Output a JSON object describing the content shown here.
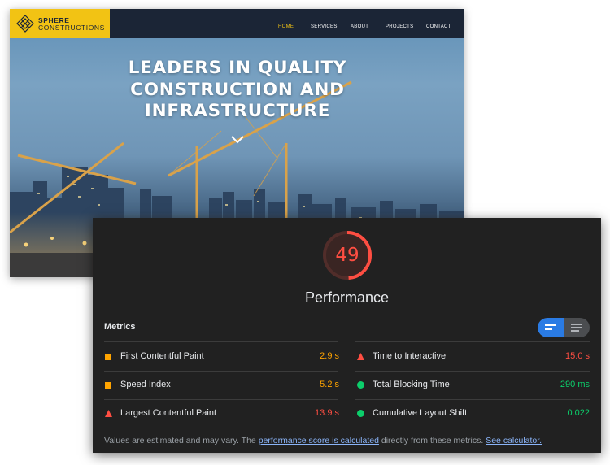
{
  "site": {
    "logo": {
      "line1": "SPHERE",
      "line2": "CONSTRUCTIONS",
      "color": "#f2c314"
    },
    "nav": [
      "HOME",
      "SERVICES",
      "ABOUT",
      "PROJECTS",
      "CONTACT"
    ],
    "nav_active": "HOME",
    "hero_title": "LEADERS IN QUALITY CONSTRUCTION AND INFRASTRUCTURE",
    "scroll_icon": "chevron-down-icon"
  },
  "report": {
    "score": "49",
    "score_fraction": 0.49,
    "score_color": "#ff4e42",
    "category": "Performance",
    "metrics_heading": "Metrics",
    "view_toggle": {
      "selected": "compact",
      "icons": [
        "compact-view-icon",
        "list-view-icon"
      ]
    },
    "metrics": [
      {
        "label": "First Contentful Paint",
        "value": "2.9 s",
        "status": "average",
        "icon": "orange-square-icon",
        "color": "#ffa400"
      },
      {
        "label": "Time to Interactive",
        "value": "15.0 s",
        "status": "fail",
        "icon": "red-triangle-icon",
        "color": "#ff4e42"
      },
      {
        "label": "Speed Index",
        "value": "5.2 s",
        "status": "average",
        "icon": "orange-square-icon",
        "color": "#ffa400"
      },
      {
        "label": "Total Blocking Time",
        "value": "290 ms",
        "status": "pass",
        "icon": "green-circle-icon",
        "color": "#0cce6b"
      },
      {
        "label": "Largest Contentful Paint",
        "value": "13.9 s",
        "status": "fail",
        "icon": "red-triangle-icon",
        "color": "#ff4e42"
      },
      {
        "label": "Cumulative Layout Shift",
        "value": "0.022",
        "status": "pass",
        "icon": "green-circle-icon",
        "color": "#0cce6b"
      }
    ],
    "footnote": {
      "prefix": "Values are estimated and may vary. The ",
      "link1": "performance score is calculated",
      "middle": " directly from these metrics. ",
      "link2": "See calculator."
    }
  }
}
